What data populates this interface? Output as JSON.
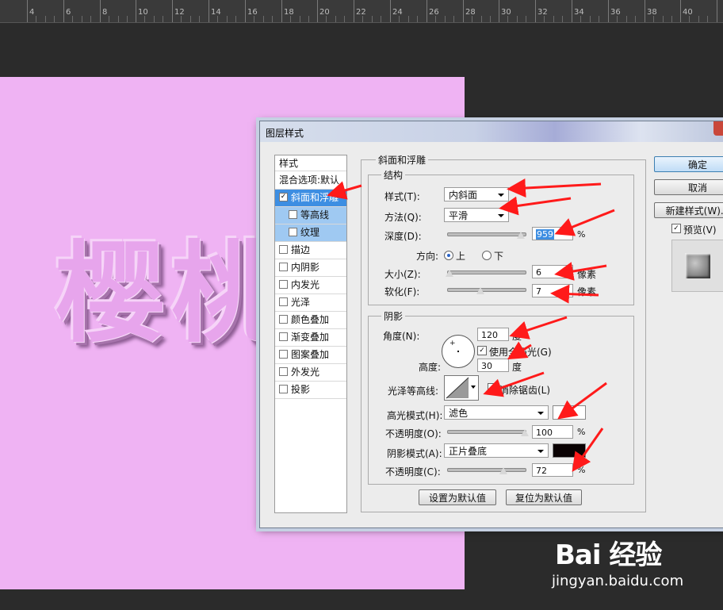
{
  "ruler": {
    "labels": [
      "4",
      "6",
      "8",
      "10",
      "12",
      "14",
      "16",
      "18",
      "20",
      "22",
      "24",
      "26",
      "28",
      "30",
      "32",
      "34",
      "36",
      "38",
      "40"
    ]
  },
  "canvas": {
    "text": "樱桃",
    "color": "#efb3f3"
  },
  "dialog": {
    "title": "图层样式",
    "styles_panel": {
      "header": "样式",
      "items": [
        {
          "label": "混合选项:默认",
          "checked": null,
          "state": "normal"
        },
        {
          "label": "斜面和浮雕",
          "checked": true,
          "state": "selected"
        },
        {
          "label": "等高线",
          "checked": false,
          "state": "sub"
        },
        {
          "label": "纹理",
          "checked": false,
          "state": "sub"
        },
        {
          "label": "描边",
          "checked": false,
          "state": "normal"
        },
        {
          "label": "内阴影",
          "checked": false,
          "state": "normal"
        },
        {
          "label": "内发光",
          "checked": false,
          "state": "normal"
        },
        {
          "label": "光泽",
          "checked": false,
          "state": "normal"
        },
        {
          "label": "颜色叠加",
          "checked": false,
          "state": "normal"
        },
        {
          "label": "渐变叠加",
          "checked": false,
          "state": "normal"
        },
        {
          "label": "图案叠加",
          "checked": false,
          "state": "normal"
        },
        {
          "label": "外发光",
          "checked": false,
          "state": "normal"
        },
        {
          "label": "投影",
          "checked": false,
          "state": "normal"
        }
      ]
    },
    "bevel": {
      "group_title": "斜面和浮雕",
      "structure": {
        "title": "结构",
        "style_label": "样式(T):",
        "style_value": "内斜面",
        "technique_label": "方法(Q):",
        "technique_value": "平滑",
        "depth_label": "深度(D):",
        "depth_value": "959",
        "depth_unit": "%",
        "depth_level": 0.95,
        "direction_label": "方向:",
        "direction_up": "上",
        "direction_down": "下",
        "size_label": "大小(Z):",
        "size_value": "6",
        "size_unit": "像素",
        "size_level": 0.03,
        "soften_label": "软化(F):",
        "soften_value": "7",
        "soften_unit": "像素",
        "soften_level": 0.43
      },
      "shading": {
        "title": "阴影",
        "angle_label": "角度(N):",
        "angle_value": "120",
        "angle_unit": "度",
        "global_light_label": "使用全局光(G)",
        "altitude_label": "高度:",
        "altitude_value": "30",
        "altitude_unit": "度",
        "gloss_contour_label": "光泽等高线:",
        "anti_alias_label": "消除锯齿(L)",
        "highlight_mode_label": "高光模式(H):",
        "highlight_mode_value": "滤色",
        "highlight_color": "#ffffff",
        "highlight_opacity_label": "不透明度(O):",
        "highlight_opacity_value": "100",
        "highlight_opacity_unit": "%",
        "highlight_opacity_level": 1.0,
        "shadow_mode_label": "阴影模式(A):",
        "shadow_mode_value": "正片叠底",
        "shadow_color": "#0a0203",
        "shadow_opacity_label": "不透明度(C):",
        "shadow_opacity_value": "72",
        "shadow_opacity_unit": "%",
        "shadow_opacity_level": 0.72
      },
      "make_default_label": "设置为默认值",
      "reset_default_label": "复位为默认值"
    },
    "buttons": {
      "ok": "确定",
      "cancel": "取消",
      "new_style": "新建样式(W)...",
      "preview_label": "预览(V)"
    }
  },
  "watermark": {
    "brand": "Bai 经验",
    "url": "jingyan.baidu.com"
  },
  "colors": {
    "arrow": "#ff1a1a",
    "selection": "#3d8ee2",
    "sub_selection": "#9fc9f2",
    "workspace": "#2b2b2b"
  }
}
